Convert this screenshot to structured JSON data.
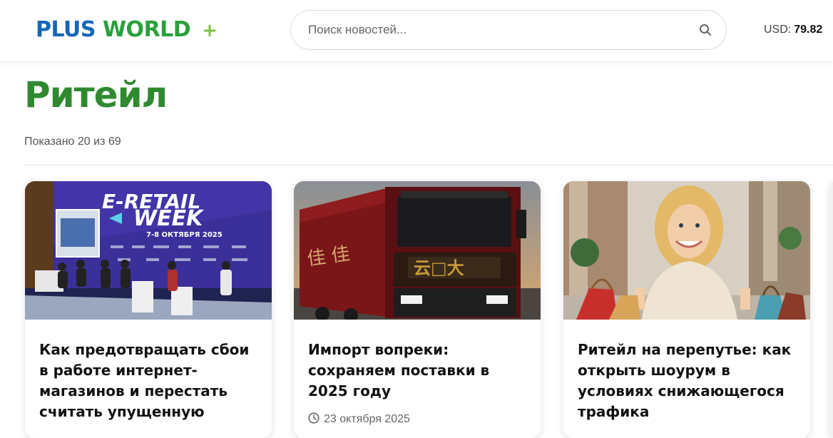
{
  "header": {
    "logo": {
      "part1": "PLUS",
      "part2": "WORLD",
      "plus": "+"
    },
    "search": {
      "placeholder": "Поиск новостей...",
      "icon": "search-icon"
    },
    "currency": {
      "label": "USD:",
      "value": "79.82"
    }
  },
  "main": {
    "title": "Ритейл",
    "count_text": "Показано 20 из 69",
    "cards": [
      {
        "title": "Как предотвращать сбои в работе интернет-магазинов и перестать считать упущенную",
        "date": ""
      },
      {
        "title": "Импорт вопреки: сохраняем поставки в 2025 году",
        "date": "23 октября 2025"
      },
      {
        "title": "Ритейл на перепутье: как открыть шоурум в условиях снижающегося трафика",
        "date": ""
      }
    ],
    "card_images": {
      "card0_banner_line1": "E-RETAIL",
      "card0_banner_line2": "WEEK",
      "card0_banner_date": "7-8 ОКТЯБРЯ 2025"
    }
  },
  "colors": {
    "title_green": "#2f8a2f",
    "logo_blue": "#1567b8",
    "logo_green": "#2aa03c",
    "logo_plus": "#7cc242"
  }
}
